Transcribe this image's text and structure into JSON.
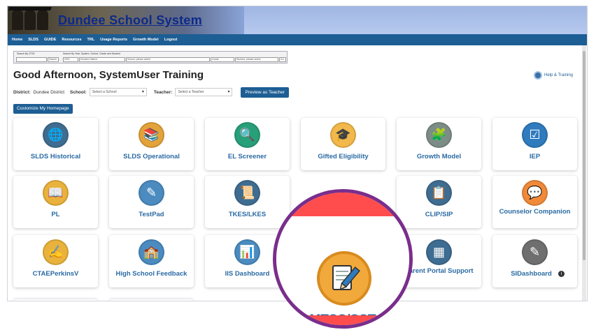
{
  "app": {
    "title": "Dundee School System"
  },
  "nav": [
    "Home",
    "SLDS",
    "GUIDE",
    "Resources",
    "TRL",
    "Usage Reports",
    "Growth Model",
    "Logout"
  ],
  "search": {
    "gtid_label": "Search By GTID",
    "gtid_button": "Search",
    "filters_label": "Search By Year, System, School, Grade and Student",
    "year": "2021",
    "district": "Dundee District",
    "school": "School, please select",
    "grade": "Grade",
    "student": "Student, please select",
    "go_button": "Go"
  },
  "greeting": "Good Afternoon, SystemUser Training",
  "help_label": "Help & Training",
  "filters": {
    "district_label": "District:",
    "district_value": "Dundee District",
    "school_label": "School:",
    "school_placeholder": "Select a School",
    "teacher_label": "Teacher:",
    "teacher_placeholder": "Select a Teacher",
    "preview_button": "Preview as Teacher"
  },
  "customize_button": "Customize My Homepage",
  "tiles": [
    {
      "label": "SLDS Historical",
      "icon": "globe-books-icon",
      "color": "#3f6d91"
    },
    {
      "label": "SLDS Operational",
      "icon": "books-icon",
      "color": "#e3a33a"
    },
    {
      "label": "EL Screener",
      "icon": "magnifier-document-icon",
      "color": "#27a07a"
    },
    {
      "label": "Gifted Eligibility",
      "icon": "graduation-cap-icon",
      "color": "#f2b84b"
    },
    {
      "label": "Growth Model",
      "icon": "puzzle-chart-icon",
      "color": "#7d8c86"
    },
    {
      "label": "IEP",
      "icon": "checklist-icon",
      "color": "#2f7bbd"
    },
    {
      "label": "PL",
      "icon": "open-book-icon",
      "color": "#e9b23c"
    },
    {
      "label": "TestPad",
      "icon": "pencil-paper-icon",
      "color": "#4b8bc0"
    },
    {
      "label": "TKES/LKES",
      "icon": "certificate-icon",
      "color": "#3f6d91"
    },
    {
      "label": "CLIP/SIP",
      "icon": "clipboard-list-icon",
      "color": "#3f6d91"
    },
    {
      "label": "Counselor Companion",
      "icon": "chat-bubbles-icon",
      "color": "#f08a3a"
    },
    {
      "label": "CTAEPerkinsV",
      "icon": "writing-paper-icon",
      "color": "#e9b23c"
    },
    {
      "label": "High School Feedback",
      "icon": "school-building-icon",
      "color": "#4b8bc0"
    },
    {
      "label": "IIS Dashboard",
      "icon": "bar-chart-icon",
      "color": "#4b8bc0"
    },
    {
      "label": "Parent Portal Support",
      "icon": "browser-window-icon",
      "color": "#3f6d91"
    },
    {
      "label": "SIDashboard",
      "icon": "edit-document-icon",
      "color": "#6f6f6f"
    }
  ],
  "zoom": {
    "label": "MTSS/SST",
    "icon": "notepad-pencil-icon",
    "color": "#f2a93b",
    "ring_color": "#7a2e8c"
  }
}
